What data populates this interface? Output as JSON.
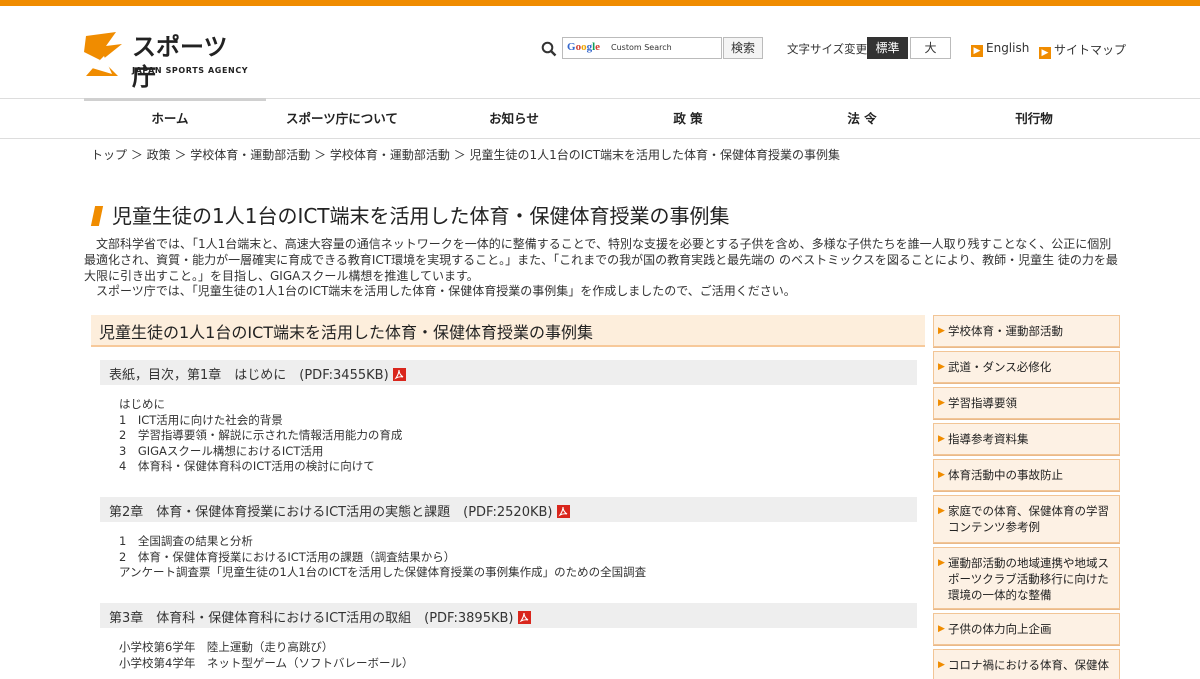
{
  "header": {
    "logo_text": "スポーツ庁",
    "logo_sub": "JAPAN SPORTS AGENCY",
    "google_word": "Google",
    "search_placeholder": "Custom Search",
    "search_button": "検索",
    "font_size_label": "文字サイズ変更",
    "font_size_standard": "標準",
    "font_size_large": "大",
    "english_link": "English",
    "sitemap_link": "サイトマップ",
    "accent_color": "#f08c00"
  },
  "nav": {
    "items": [
      "ホーム",
      "スポーツ庁について",
      "お知らせ",
      "政 策",
      "法 令",
      "刊行物"
    ]
  },
  "breadcrumb": "トップ ＞ 政策 ＞ 学校体育・運動部活動 ＞ 学校体育・運動部活動 ＞ 児童生徒の1人1台のICT端末を活用した体育・保健体育授業の事例集",
  "page": {
    "title": "児童生徒の1人1台のICT端末を活用した体育・保健体育授業の事例集",
    "intro_1": "文部科学省では、「1人1台端末と、高速大容量の通信ネットワークを一体的に整備することで、特別な支援を必要とする子供を含め、多様な子供たちを誰一人取り残すことなく、公正に個別最適化され、資質・能力が一層確実に育成できる教育ICT環境を実現すること。」また、「これまでの我が国の教育実践と最先端の のベストミックスを図ることにより、教師・児童生 徒の力を最大限に引き出すこと。」を目指し、GIGAスクール構想を推進しています。",
    "intro_2": "スポーツ庁では、「児童生徒の1人1台のICT端末を活用した体育・保健体育授業の事例集」を作成しましたので、ご活用ください。"
  },
  "main": {
    "section_title": "児童生徒の1人1台のICT端末を活用した体育・保健体育授業の事例集",
    "chapters": [
      {
        "title": "表紙，目次，第1章　はじめに　(PDF:3455KB)",
        "items": [
          "はじめに",
          "1　ICT活用に向けた社会的背景",
          "2　学習指導要領・解説に示された情報活用能力の育成",
          "3　GIGAスクール構想におけるICT活用",
          "4　体育科・保健体育科のICT活用の検討に向けて"
        ]
      },
      {
        "title": "第2章　体育・保健体育授業におけるICT活用の実態と課題　(PDF:2520KB)",
        "items": [
          "1　全国調査の結果と分析",
          "2　体育・保健体育授業におけるICT活用の課題（調査結果から）",
          "アンケート調査票「児童生徒の1人1台のICTを活用した保健体育授業の事例集作成」のための全国調査"
        ]
      },
      {
        "title": "第3章　体育科・保健体育科におけるICT活用の取組　(PDF:3895KB)",
        "items": [
          "小学校第6学年　陸上運動（走り高跳び）",
          "小学校第4学年　ネット型ゲーム（ソフトバレーボール）"
        ]
      }
    ]
  },
  "sidebar": {
    "items": [
      "学校体育・運動部活動",
      "武道・ダンス必修化",
      "学習指導要領",
      "指導参考資料集",
      "体育活動中の事故防止",
      "家庭での体育、保健体育の学習コンテンツ参考例",
      "運動部活動の地域連携や地域スポーツクラブ活動移行に向けた環境の一体的な整備",
      "子供の体力向上企画",
      "コロナ禍における体育、保健体"
    ]
  }
}
